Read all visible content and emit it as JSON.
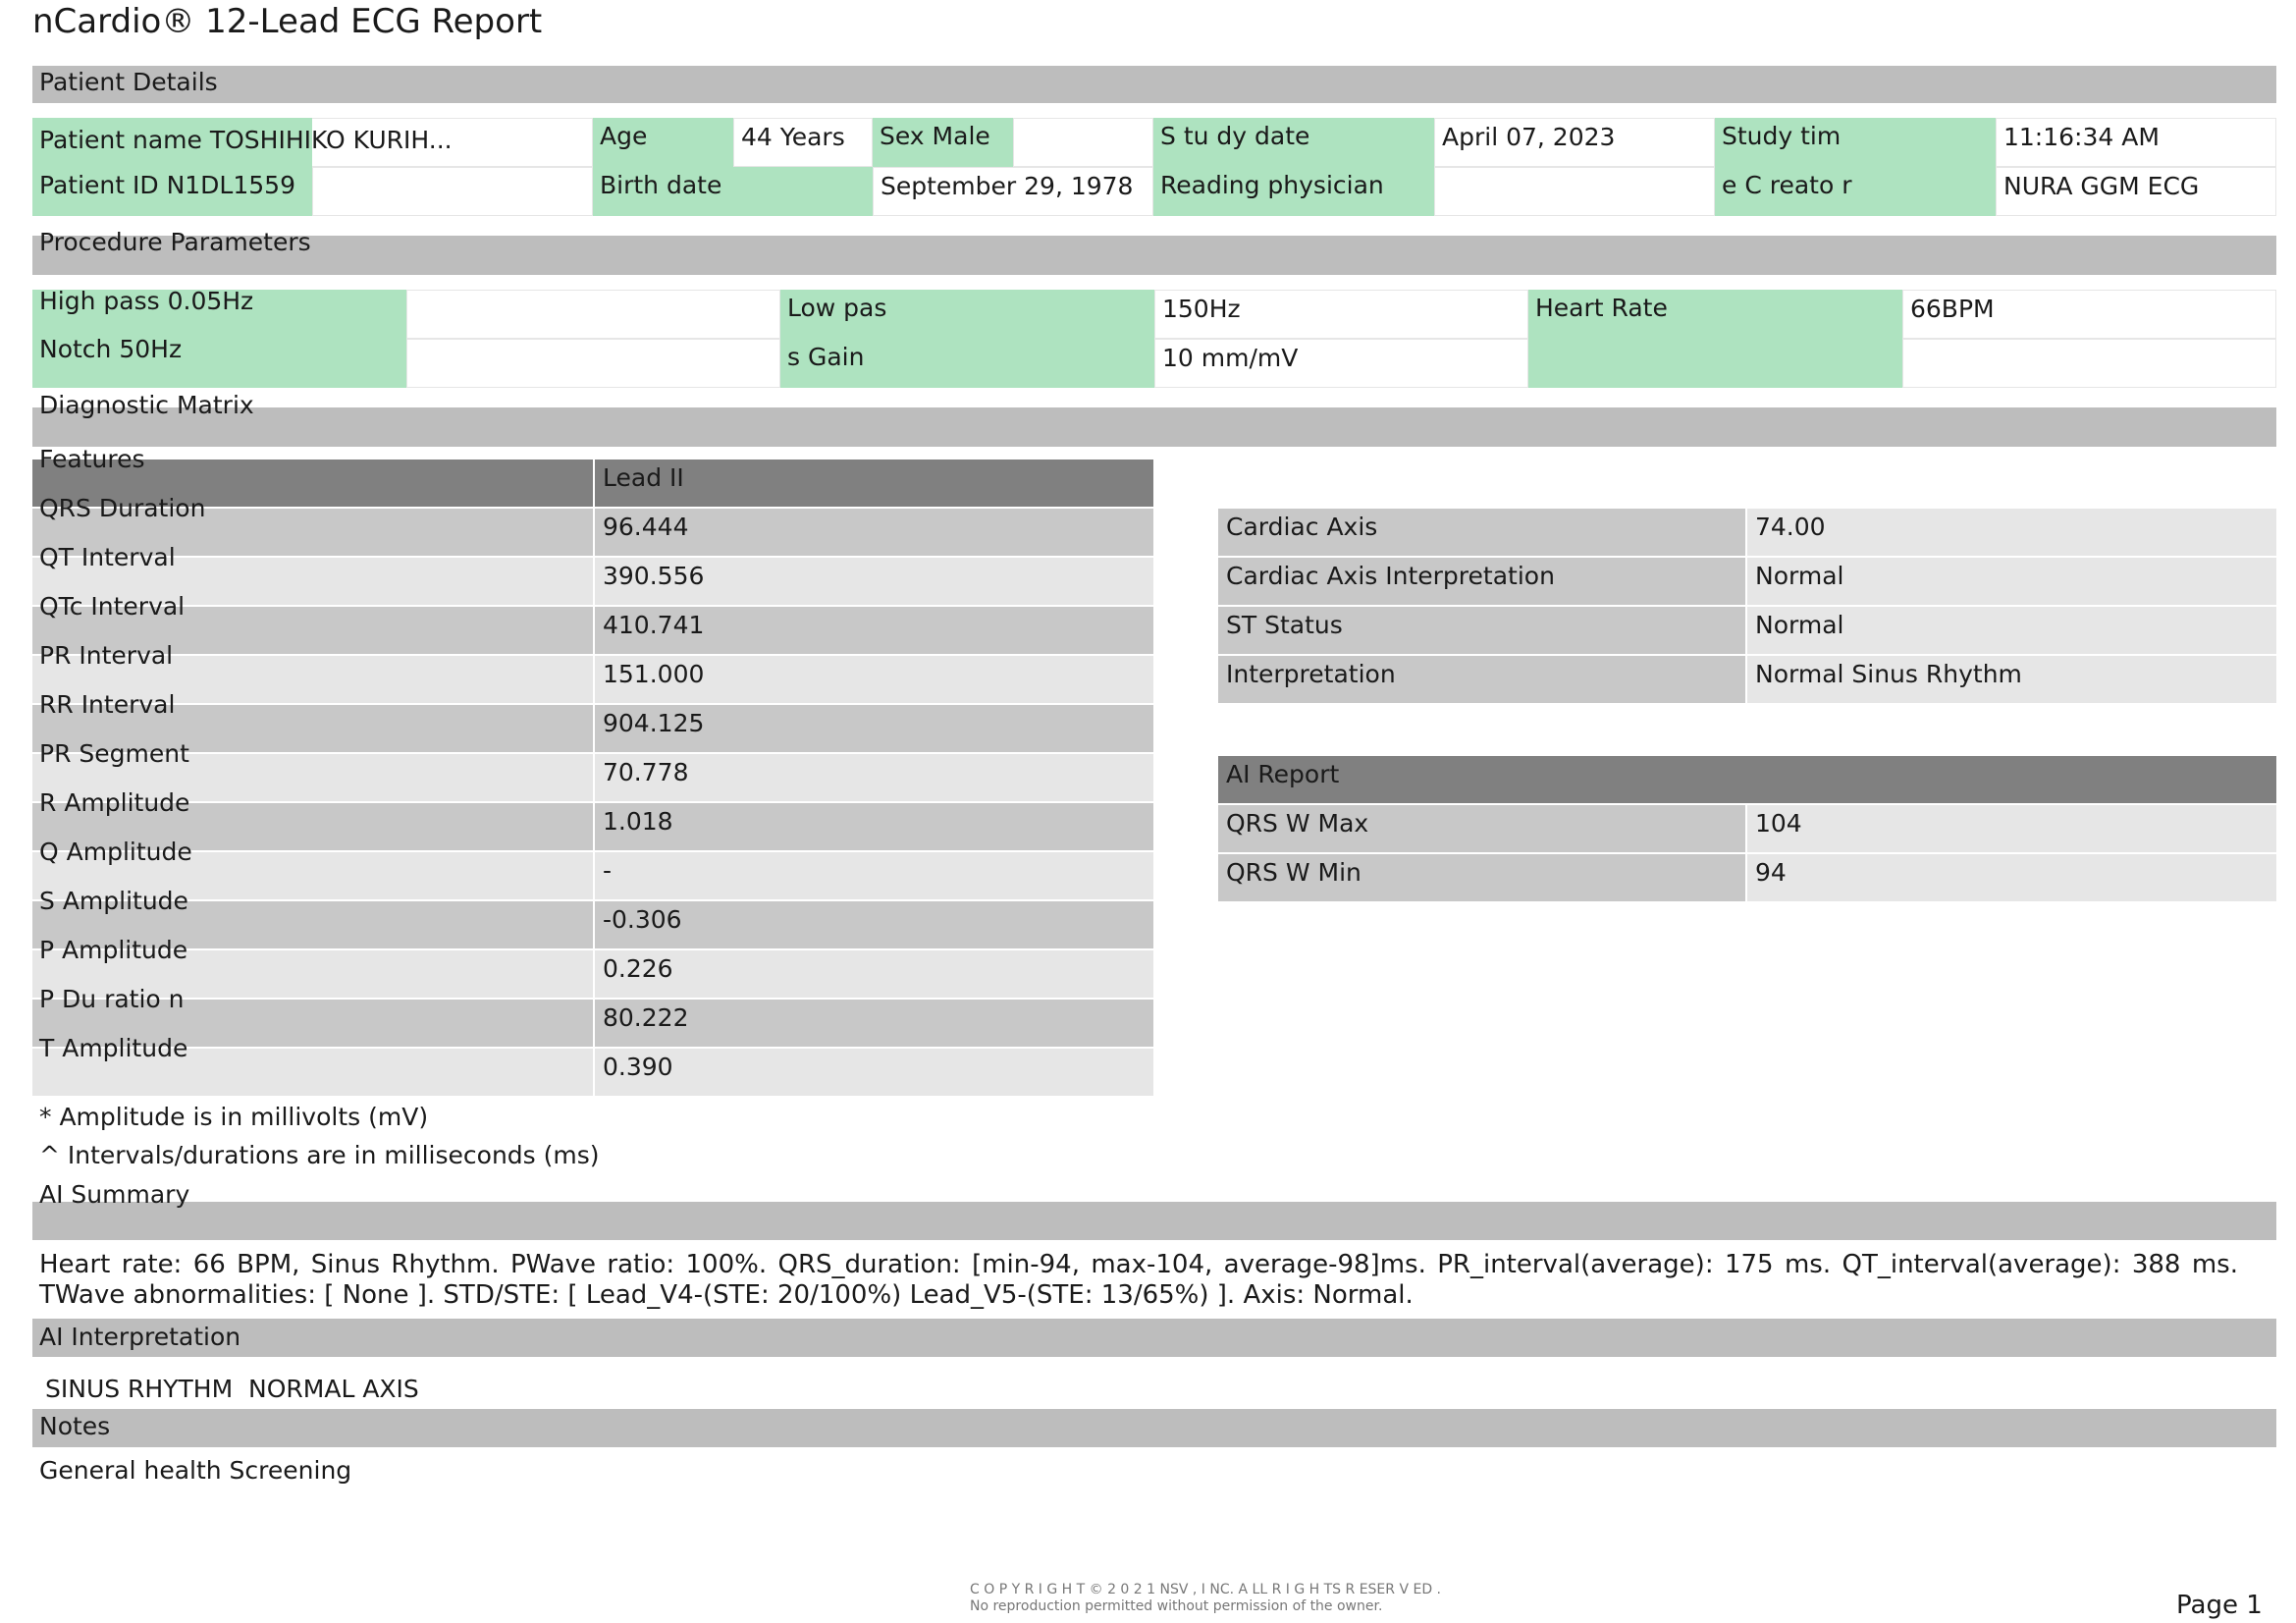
{
  "header": {
    "title": "nCardio® 12-Lead ECG Report"
  },
  "patient_details": {
    "section_title": "Patient Details",
    "patient_name": "Patient name TOSHIHIKO KURIH...",
    "age_label": "Age",
    "age_value": "44 Years",
    "sex": "Sex Male",
    "study_date_label": "S tu dy  date",
    "study_date_value": "April 07, 2023",
    "study_time_label": "Study    tim",
    "study_time_value": "11:16:34 AM",
    "patient_id": "Patient ID N1DL1559",
    "birth_date_label": "Birth date",
    "birth_date_value": "September 29, 1978",
    "reading_physician_label": "Reading physician",
    "reading_physician_value": "",
    "creator_label": "e C reato r",
    "creator_value": "NURA GGM ECG"
  },
  "procedure_parameters": {
    "section_title": "Procedure Parameters",
    "high_pass": "High pass 0.05Hz",
    "notch": "Notch 50Hz",
    "low_pass_label": "Low   pas",
    "low_pass_value": "150Hz",
    "gain_label": "s Gain",
    "gain_value": "10 mm/mV",
    "heart_rate_label": "Heart Rate",
    "heart_rate_value": "66BPM"
  },
  "diagnostic_matrix": {
    "section_title": "Diagnostic Matrix",
    "features_header": "Features",
    "lead_header": "Lead II",
    "rows": [
      {
        "feature": "QRS Duration",
        "value": "96.444"
      },
      {
        "feature": "QT Interval",
        "value": "390.556"
      },
      {
        "feature": "QTc Interval",
        "value": "410.741"
      },
      {
        "feature": "PR Interval",
        "value": "151.000"
      },
      {
        "feature": "RR Interval",
        "value": "904.125"
      },
      {
        "feature": "PR Segment",
        "value": "70.778"
      },
      {
        "feature": "R Amplitude",
        "value": "1.018"
      },
      {
        "feature": "Q Amplitude",
        "value": "-"
      },
      {
        "feature": "S Amplitude",
        "value": "-0.306"
      },
      {
        "feature": "P Amplitude",
        "value": "0.226"
      },
      {
        "feature": "P  Du ratio n",
        "value": "80.222"
      },
      {
        "feature": "T Amplitude",
        "value": "0.390"
      }
    ],
    "axis_rows": [
      {
        "label": "Cardiac Axis",
        "value": "74.00"
      },
      {
        "label": "Cardiac Axis Interpretation",
        "value": "Normal"
      },
      {
        "label": "ST Status",
        "value": "Normal"
      },
      {
        "label": "Interpretation",
        "value": "Normal Sinus Rhythm"
      }
    ],
    "ai_report": {
      "header": "AI Report",
      "rows": [
        {
          "label": "QRS W Max",
          "value": "104"
        },
        {
          "label": "QRS W Min",
          "value": "94"
        }
      ]
    },
    "footnote_amplitude": "* Amplitude is in millivolts (mV)",
    "footnote_intervals": "^ Intervals/durations are in milliseconds (ms)"
  },
  "ai_summary": {
    "section_title": "AI Summary",
    "text": "Heart rate: 66 BPM, Sinus Rhythm. PWave ratio: 100%. QRS_duration: [min-94, max-104, average-98]ms. PR_interval(average): 175 ms. QT_interval(average): 388 ms. TWave abnormalities: [ None ]. STD/STE: [ Lead_V4-(STE: 20/100%) Lead_V5-(STE: 13/65%) ]. Axis: Normal."
  },
  "ai_interpretation": {
    "section_title": "AI Interpretation",
    "text": "SINUS RHYTHM  NORMAL AXIS"
  },
  "notes": {
    "section_title": "Notes",
    "text": "General health Screening"
  },
  "footer": {
    "copyright_line1": "C O P Y R I G H T © 2 0 2 1  NSV ,  I NC. A LL R I G H TS R ESER V ED .",
    "copyright_line2": "No reproduction permitted without permission of the owner.",
    "page": "Page 1"
  }
}
